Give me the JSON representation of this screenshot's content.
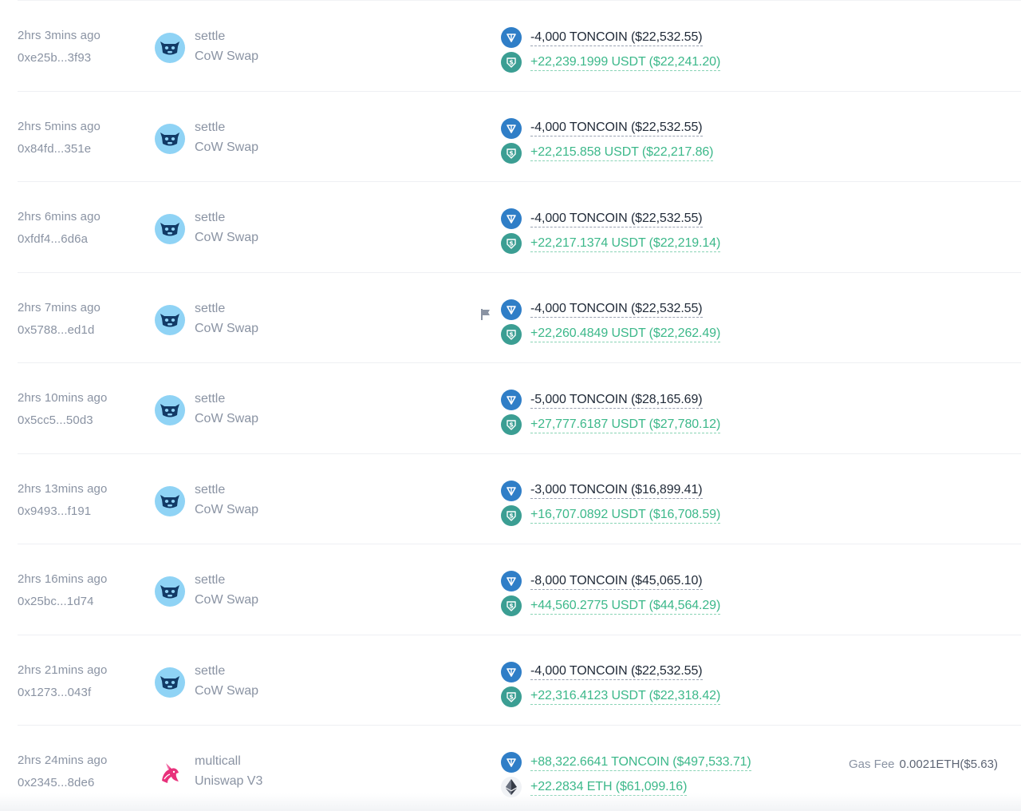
{
  "rows": [
    {
      "time": "2hrs 3mins ago",
      "hash": "0xe25b...3f93",
      "method": "settle",
      "protocol": "CoW Swap",
      "protocol_icon": "cow-icon",
      "flag": false,
      "tokens": [
        {
          "icon": "ton",
          "sign": "neg",
          "text": "-4,000 TONCOIN ($22,532.55)"
        },
        {
          "icon": "usdt",
          "sign": "pos",
          "text": "+22,239.1999 USDT ($22,241.20)"
        }
      ]
    },
    {
      "time": "2hrs 5mins ago",
      "hash": "0x84fd...351e",
      "method": "settle",
      "protocol": "CoW Swap",
      "protocol_icon": "cow-icon",
      "flag": false,
      "tokens": [
        {
          "icon": "ton",
          "sign": "neg",
          "text": "-4,000 TONCOIN ($22,532.55)"
        },
        {
          "icon": "usdt",
          "sign": "pos",
          "text": "+22,215.858 USDT ($22,217.86)"
        }
      ]
    },
    {
      "time": "2hrs 6mins ago",
      "hash": "0xfdf4...6d6a",
      "method": "settle",
      "protocol": "CoW Swap",
      "protocol_icon": "cow-icon",
      "flag": false,
      "tokens": [
        {
          "icon": "ton",
          "sign": "neg",
          "text": "-4,000 TONCOIN ($22,532.55)"
        },
        {
          "icon": "usdt",
          "sign": "pos",
          "text": "+22,217.1374 USDT ($22,219.14)"
        }
      ]
    },
    {
      "time": "2hrs 7mins ago",
      "hash": "0x5788...ed1d",
      "method": "settle",
      "protocol": "CoW Swap",
      "protocol_icon": "cow-icon",
      "flag": true,
      "tokens": [
        {
          "icon": "ton",
          "sign": "neg",
          "text": "-4,000 TONCOIN ($22,532.55)"
        },
        {
          "icon": "usdt",
          "sign": "pos",
          "text": "+22,260.4849 USDT ($22,262.49)"
        }
      ]
    },
    {
      "time": "2hrs 10mins ago",
      "hash": "0x5cc5...50d3",
      "method": "settle",
      "protocol": "CoW Swap",
      "protocol_icon": "cow-icon",
      "flag": false,
      "tokens": [
        {
          "icon": "ton",
          "sign": "neg",
          "text": "-5,000 TONCOIN ($28,165.69)"
        },
        {
          "icon": "usdt",
          "sign": "pos",
          "text": "+27,777.6187 USDT ($27,780.12)"
        }
      ]
    },
    {
      "time": "2hrs 13mins ago",
      "hash": "0x9493...f191",
      "method": "settle",
      "protocol": "CoW Swap",
      "protocol_icon": "cow-icon",
      "flag": false,
      "tokens": [
        {
          "icon": "ton",
          "sign": "neg",
          "text": "-3,000 TONCOIN ($16,899.41)"
        },
        {
          "icon": "usdt",
          "sign": "pos",
          "text": "+16,707.0892 USDT ($16,708.59)"
        }
      ]
    },
    {
      "time": "2hrs 16mins ago",
      "hash": "0x25bc...1d74",
      "method": "settle",
      "protocol": "CoW Swap",
      "protocol_icon": "cow-icon",
      "flag": false,
      "tokens": [
        {
          "icon": "ton",
          "sign": "neg",
          "text": "-8,000 TONCOIN ($45,065.10)"
        },
        {
          "icon": "usdt",
          "sign": "pos",
          "text": "+44,560.2775 USDT ($44,564.29)"
        }
      ]
    },
    {
      "time": "2hrs 21mins ago",
      "hash": "0x1273...043f",
      "method": "settle",
      "protocol": "CoW Swap",
      "protocol_icon": "cow-icon",
      "flag": false,
      "tokens": [
        {
          "icon": "ton",
          "sign": "neg",
          "text": "-4,000 TONCOIN ($22,532.55)"
        },
        {
          "icon": "usdt",
          "sign": "pos",
          "text": "+22,316.4123 USDT ($22,318.42)"
        }
      ]
    },
    {
      "time": "2hrs 24mins ago",
      "hash": "0x2345...8de6",
      "method": "multicall",
      "protocol": "Uniswap V3",
      "protocol_icon": "unicorn-icon",
      "flag": false,
      "tokens": [
        {
          "icon": "ton",
          "sign": "pos",
          "text": "+88,322.6641 TONCOIN ($497,533.71)"
        },
        {
          "icon": "eth",
          "sign": "pos",
          "text": "+22.2834 ETH ($61,099.16)"
        }
      ],
      "gas": {
        "label": "Gas Fee",
        "value": "0.0021ETH($5.63)"
      }
    }
  ],
  "colors": {
    "negative": "#1f2937",
    "positive": "#3cb88a",
    "muted": "#8a93a3",
    "ton": "#2f7ec7",
    "usdt": "#3b9e93",
    "cow_bg": "#8fd3f5"
  }
}
